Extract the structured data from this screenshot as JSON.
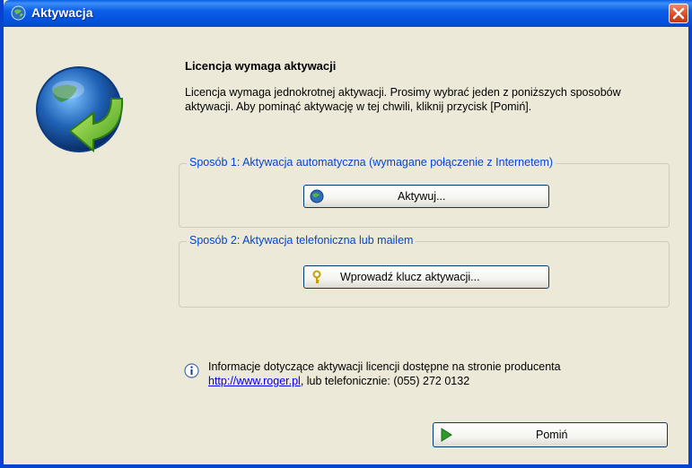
{
  "window": {
    "title": "Aktywacja"
  },
  "content": {
    "heading": "Licencja wymaga aktywacji",
    "description": "Licencja wymaga jednokrotnej aktywacji. Prosimy wybrać jeden z poniższych sposobów aktywacji. Aby pominąć aktywację w tej chwili, kliknij przycisk [Pomiń]."
  },
  "method1": {
    "label": "Sposób 1: Aktywacja automatyczna (wymagane połączenie z Internetem)",
    "button_label": "Aktywuj...",
    "button_icon": "globe-icon"
  },
  "method2": {
    "label": "Sposób 2: Aktywacja telefoniczna lub mailem",
    "button_label": "Wprowadź klucz aktywacji...",
    "button_icon": "key-icon"
  },
  "info": {
    "text": "Informacje dotyczące aktywacji licencji dostępne na stronie producenta",
    "link": "http://www.roger.pl",
    "phone_text": ", lub telefonicznie: (055) 272 0132"
  },
  "skip_button": {
    "label": "Pomiń",
    "icon": "play-arrow-icon"
  },
  "colors": {
    "titlebar": "#0550dd",
    "group_label": "#0046d5",
    "background": "#ECE9D8"
  }
}
